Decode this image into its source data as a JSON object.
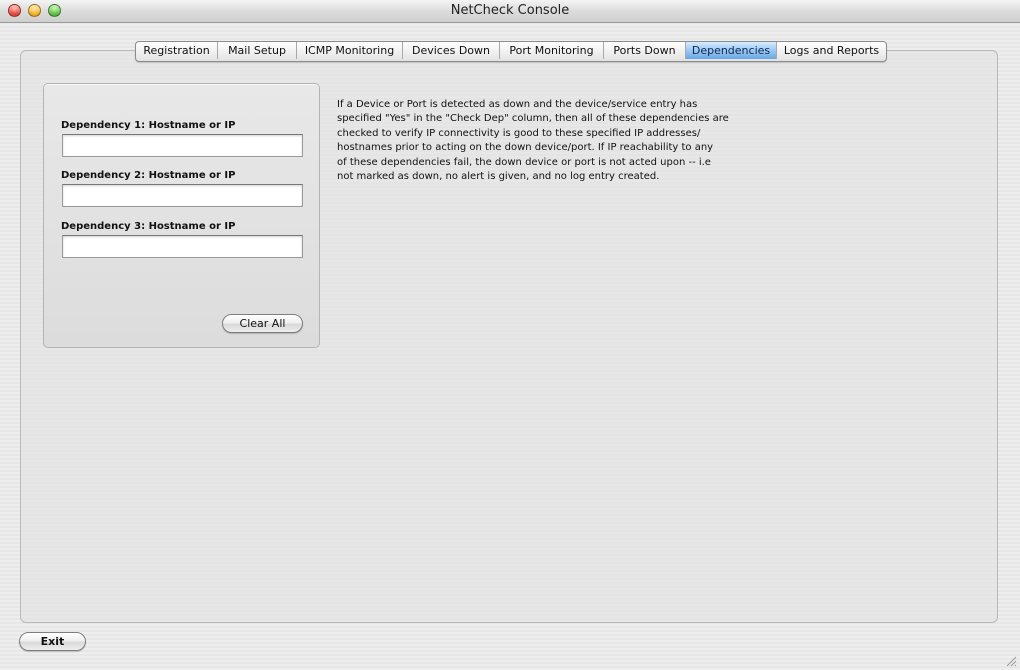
{
  "window": {
    "title": "NetCheck Console",
    "controls": [
      "close-icon",
      "minimize-icon",
      "zoom-icon"
    ]
  },
  "tabs": [
    {
      "label": "Registration",
      "active": false
    },
    {
      "label": "Mail Setup",
      "active": false
    },
    {
      "label": "ICMP Monitoring",
      "active": false
    },
    {
      "label": "Devices Down",
      "active": false
    },
    {
      "label": "Port Monitoring",
      "active": false
    },
    {
      "label": "Ports Down",
      "active": false
    },
    {
      "label": "Dependencies",
      "active": true
    },
    {
      "label": "Logs and Reports",
      "active": false
    }
  ],
  "dependencies": {
    "fields": [
      {
        "label": "Dependency 1:  Hostname or IP",
        "value": ""
      },
      {
        "label": "Dependency 2:  Hostname or IP",
        "value": ""
      },
      {
        "label": "Dependency 3:  Hostname or IP",
        "value": ""
      }
    ],
    "clear_label": "Clear All"
  },
  "description": "If a Device or Port is detected as down and the device/service entry has\nspecified \"Yes\" in the \"Check Dep\" column, then all of these dependencies are\nchecked to verify IP connectivity is good to these specified IP addresses/\nhostnames prior to acting on the down device/port.  If IP reachability to any\nof these dependencies fail, the down device or port is not acted upon -- i.e\nnot marked as down, no alert is given, and no log entry created.",
  "footer": {
    "exit_label": "Exit"
  },
  "colors": {
    "active_tab": "#9cc8f2",
    "close": "#e8493a",
    "minimize": "#f3b62a",
    "zoom": "#5fc34a"
  }
}
